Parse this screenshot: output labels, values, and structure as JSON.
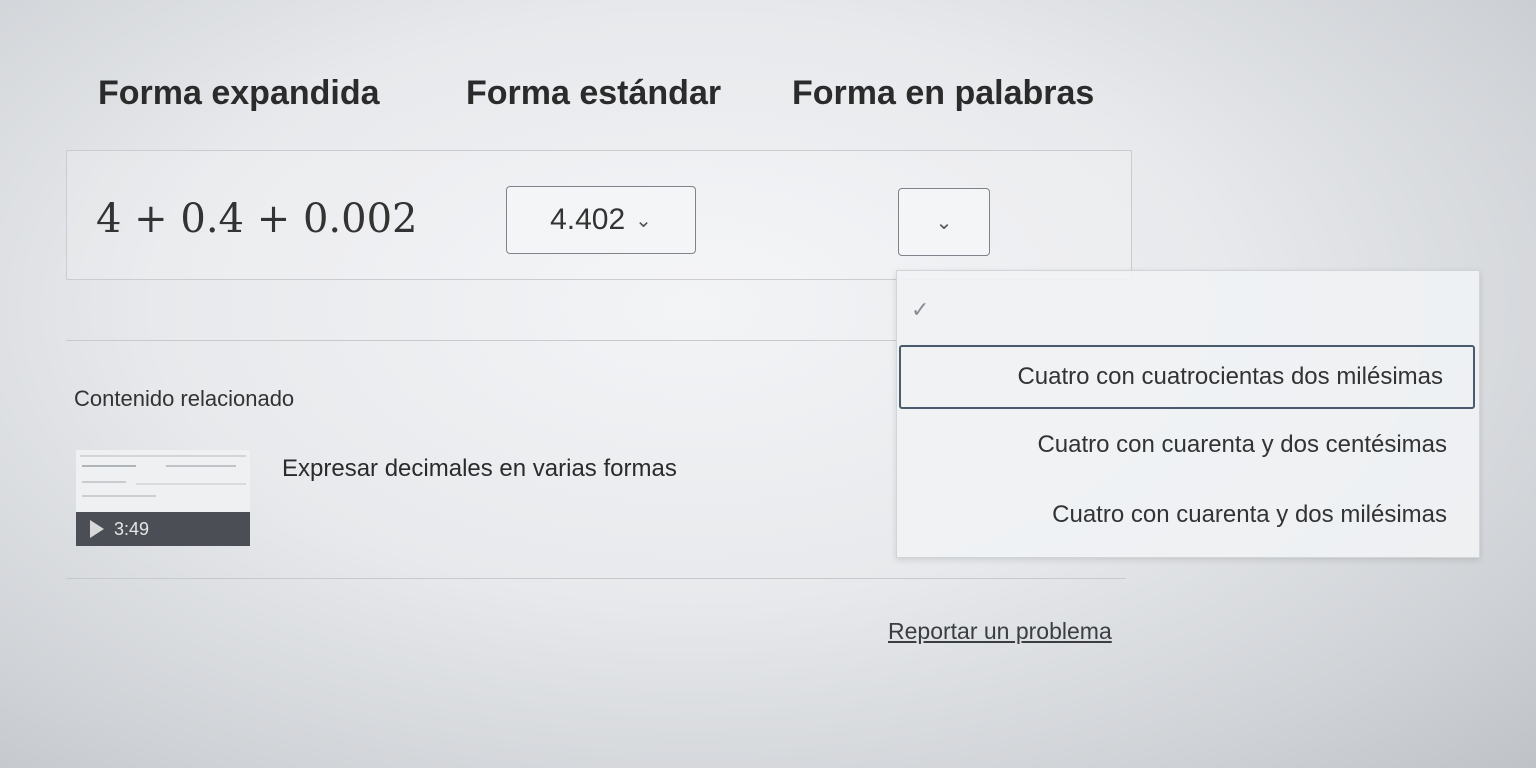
{
  "headers": [
    "Forma expandida",
    "Forma estándar",
    "Forma en palabras"
  ],
  "row": {
    "expanded": "4 + 0.4 + 0.002",
    "standard_value": "4.402",
    "words_value": ""
  },
  "dropdown": {
    "options": [
      "Cuatro con cuatrocientas dos milésimas",
      "Cuatro con cuarenta y dos centésimas",
      "Cuatro con cuarenta y dos milésimas"
    ]
  },
  "related": {
    "heading": "Contenido relacionado",
    "video_title": "Expresar decimales en varias formas",
    "video_duration": "3:49"
  },
  "report_link": "Reportar un problema",
  "icons": {
    "chevron": "chevron-down-icon",
    "check": "check-icon",
    "play": "play-icon"
  }
}
